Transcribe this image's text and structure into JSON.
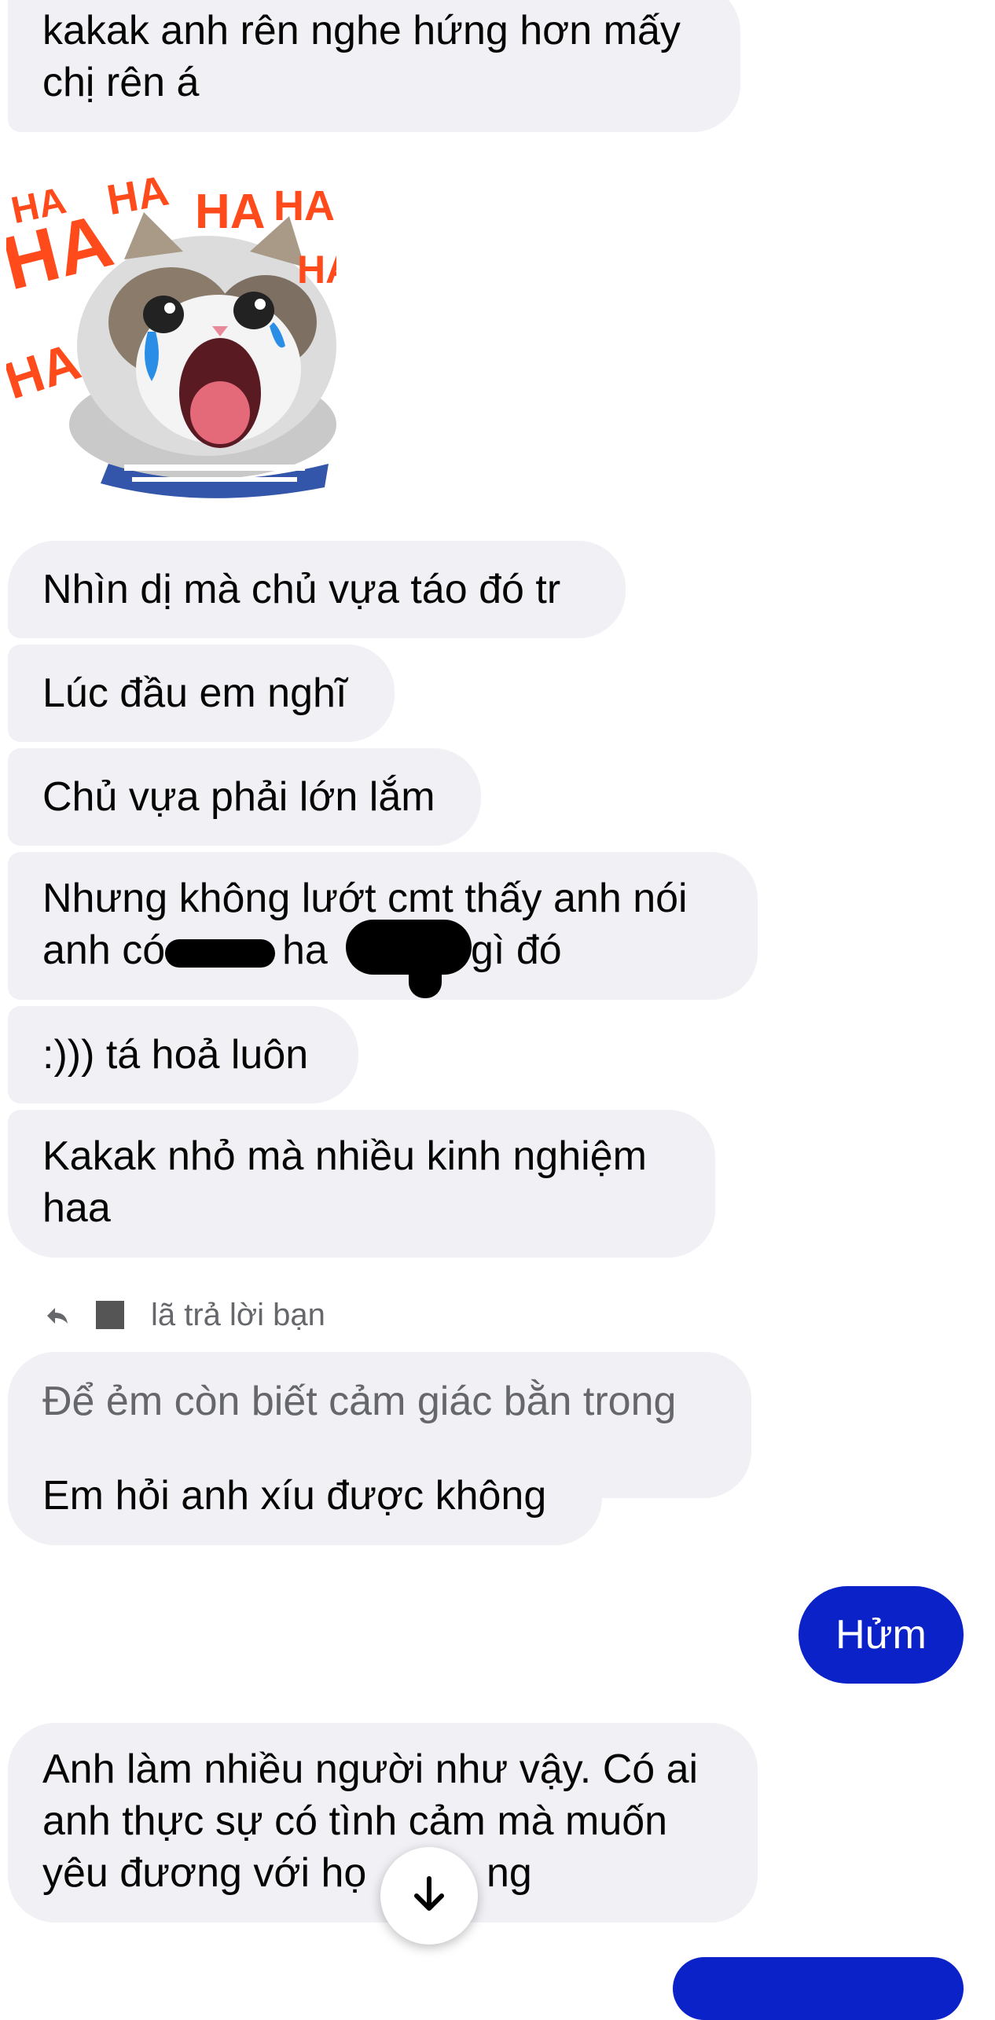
{
  "messages": {
    "m0": "kakak anh rên nghe hứng hơn mấy chị rên á",
    "m1": "Nhìn dị mà chủ vựa táo đó tr",
    "m2": "Lúc đầu em nghĩ",
    "m3": "Chủ vựa phải lớn lắm",
    "m4_line1": "Nhưng không lướt cmt thấy anh nói",
    "m4_line2a": "anh có",
    "m4_line2b": "ha",
    "m4_line2c": "gì đó",
    "m5": ":))) tá hoả luôn",
    "m6": "Kakak nhỏ mà nhiều kinh nghiệm haa",
    "reply_label": "lã trả lời bạn",
    "quoted": "Để ẻm còn biết cảm giác bằn trong",
    "m7": "Em hỏi anh xíu được không",
    "sent": "Hửm",
    "m8_line1": "Anh làm nhiều người như vậy. Có ai",
    "m8_line2": "anh thực sự có tình cảm mà muốn",
    "m8_line3a": "yêu đương với họ",
    "m8_line3b": "ng"
  },
  "sticker": {
    "laugh_text": "HA",
    "description": "crying-laughing-cat-sticker"
  },
  "colors": {
    "received_bg": "#f0f0f5",
    "sent_bg": "#0a22c8",
    "ha_orange": "#ff4a1c"
  },
  "icons": [
    "reply-arrow-icon",
    "arrow-down-icon"
  ]
}
